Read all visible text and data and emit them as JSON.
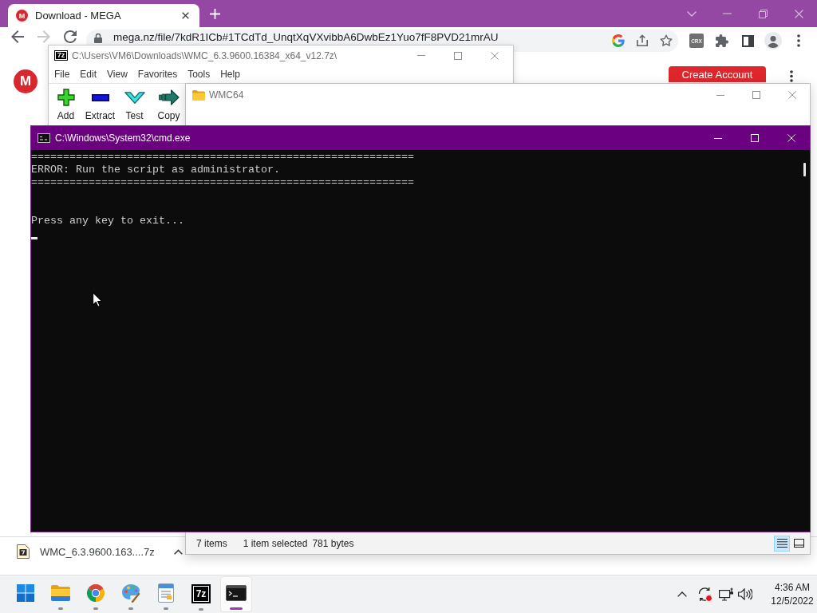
{
  "browser": {
    "tabs": [
      {
        "title": "Download - MEGA",
        "logo": "M",
        "selected": true
      }
    ],
    "nav": [
      {
        "kind": "back",
        "disabled": false
      },
      {
        "kind": "forward",
        "disabled": true
      },
      {
        "kind": "reload",
        "disabled": false
      }
    ],
    "url": "mega.nz/file/7kdR1ICb#1TCdTd_UnqtXqVXvibbA6DwbEz1Yuo7fF8PVD21mrAU",
    "extension": "CRX",
    "page": {
      "logo": "M",
      "button": "Create Account"
    },
    "downloads": [
      {
        "name": "WMC_6.3.9600.163....7z"
      }
    ]
  },
  "archiver": {
    "logo": "7z",
    "title": "C:\\Users\\VM6\\Downloads\\WMC_6.3.9600.16384_x64_v12.7z\\",
    "menu": [
      "File",
      "Edit",
      "View",
      "Favorites",
      "Tools",
      "Help"
    ],
    "toolbar": [
      {
        "kind": "add",
        "label": "Add"
      },
      {
        "kind": "extract",
        "label": "Extract"
      },
      {
        "kind": "test",
        "label": "Test"
      },
      {
        "kind": "copy",
        "label": "Copy"
      }
    ]
  },
  "explorer": {
    "title": "WMC64",
    "status": [
      "7 items",
      "1 item selected",
      "781 bytes"
    ],
    "views": [
      {
        "kind": "details",
        "selected": true
      },
      {
        "kind": "tiles",
        "selected": false
      }
    ]
  },
  "console": {
    "title": "C:\\Windows\\System32\\cmd.exe",
    "blocks": [
      [
        "============================================================",
        "ERROR: Run the script as administrator.",
        "============================================================"
      ],
      [
        "Press any key to exit..."
      ]
    ],
    "cursor": true
  },
  "taskbar": {
    "apps": [
      {
        "kind": "start",
        "running": false,
        "selected": false
      },
      {
        "kind": "files",
        "running": true,
        "selected": false
      },
      {
        "kind": "browser",
        "running": true,
        "selected": false
      },
      {
        "kind": "paint",
        "running": true,
        "selected": false
      },
      {
        "kind": "editor",
        "running": true,
        "selected": false
      },
      {
        "kind": "archiver",
        "label": "7z",
        "running": true,
        "selected": false
      },
      {
        "kind": "console",
        "running": true,
        "selected": true
      }
    ],
    "clock": {
      "time": "4:36 AM",
      "date": "12/5/2022"
    }
  }
}
